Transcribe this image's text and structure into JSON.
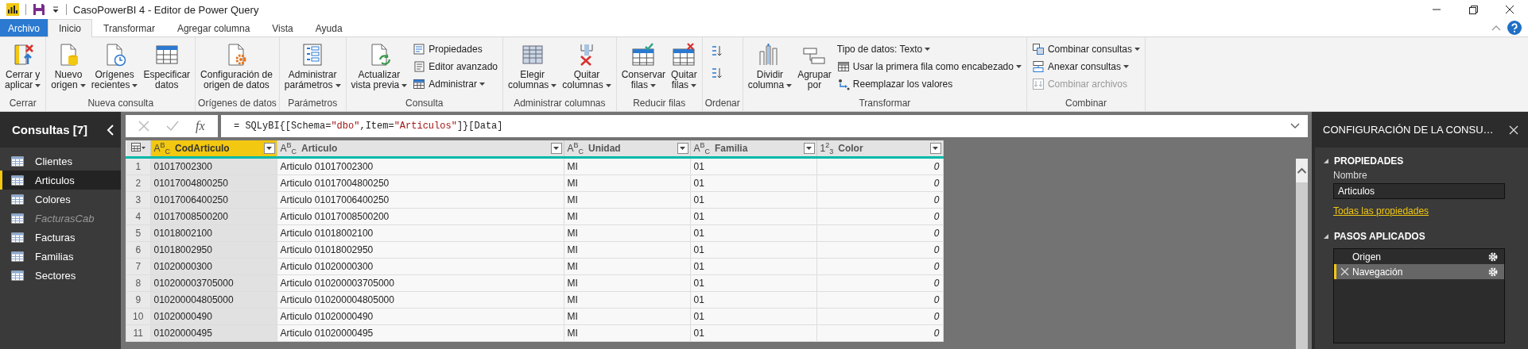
{
  "window": {
    "title": "CasoPowerBI 4 - Editor de Power Query"
  },
  "ribbon_tabs": [
    {
      "label": "Archivo",
      "kind": "file",
      "selected": false
    },
    {
      "label": "Inicio",
      "kind": "tab",
      "selected": true
    },
    {
      "label": "Transformar",
      "kind": "tab",
      "selected": false
    },
    {
      "label": "Agregar columna",
      "kind": "tab",
      "selected": false
    },
    {
      "label": "Vista",
      "kind": "tab",
      "selected": false
    },
    {
      "label": "Ayuda",
      "kind": "tab",
      "selected": false
    }
  ],
  "ribbon_groups": [
    {
      "label": "Cerrar",
      "items": [
        {
          "kind": "large",
          "lines": [
            "Cerrar y",
            "aplicar"
          ],
          "dropdown": true,
          "disabled": false
        }
      ]
    },
    {
      "label": "Nueva consulta",
      "items": [
        {
          "kind": "large",
          "lines": [
            "Nuevo",
            "origen"
          ],
          "dropdown": true,
          "disabled": false
        },
        {
          "kind": "large",
          "lines": [
            "Orígenes",
            "recientes"
          ],
          "dropdown": true,
          "disabled": false
        },
        {
          "kind": "large",
          "lines": [
            "Especificar",
            "datos"
          ],
          "dropdown": false,
          "disabled": false
        }
      ]
    },
    {
      "label": "Orígenes de datos",
      "items": [
        {
          "kind": "large",
          "lines": [
            "Configuración de",
            "origen de datos"
          ],
          "dropdown": false,
          "disabled": false
        }
      ]
    },
    {
      "label": "Parámetros",
      "items": [
        {
          "kind": "large",
          "lines": [
            "Administrar",
            "parámetros"
          ],
          "dropdown": true,
          "disabled": false
        }
      ]
    },
    {
      "label": "Consulta",
      "items": [
        {
          "kind": "large",
          "lines": [
            "Actualizar",
            "vista previa"
          ],
          "dropdown": true,
          "disabled": false
        },
        {
          "kind": "small",
          "lines": [
            "Propiedades"
          ],
          "dropdown": false,
          "disabled": false
        },
        {
          "kind": "small",
          "lines": [
            "Editor avanzado"
          ],
          "dropdown": false,
          "disabled": false
        },
        {
          "kind": "small",
          "lines": [
            "Administrar"
          ],
          "dropdown": true,
          "disabled": false
        }
      ]
    },
    {
      "label": "Administrar columnas",
      "items": [
        {
          "kind": "large",
          "lines": [
            "Elegir",
            "columnas"
          ],
          "dropdown": true,
          "disabled": false
        },
        {
          "kind": "large",
          "lines": [
            "Quitar",
            "columnas"
          ],
          "dropdown": true,
          "disabled": false
        }
      ]
    },
    {
      "label": "Reducir filas",
      "items": [
        {
          "kind": "large",
          "lines": [
            "Conservar",
            "filas"
          ],
          "dropdown": true,
          "disabled": false
        },
        {
          "kind": "large",
          "lines": [
            "Quitar",
            "filas"
          ],
          "dropdown": true,
          "disabled": false
        }
      ]
    },
    {
      "label": "Ordenar",
      "items": [
        {
          "kind": "icon",
          "disabled": false
        },
        {
          "kind": "icon",
          "disabled": false
        }
      ]
    },
    {
      "label": "Transformar",
      "items": [
        {
          "kind": "large",
          "lines": [
            "Dividir",
            "columna"
          ],
          "dropdown": true,
          "disabled": false
        },
        {
          "kind": "large",
          "lines": [
            "Agrupar",
            "por"
          ],
          "dropdown": false,
          "disabled": false
        },
        {
          "kind": "small",
          "lines": [
            "Tipo de datos: Texto"
          ],
          "dropdown": true,
          "disabled": false
        },
        {
          "kind": "small",
          "lines": [
            "Usar la primera fila como encabezado"
          ],
          "dropdown": true,
          "disabled": false
        },
        {
          "kind": "small",
          "lines": [
            "Reemplazar los valores"
          ],
          "dropdown": false,
          "disabled": false
        }
      ]
    },
    {
      "label": "Combinar",
      "items": [
        {
          "kind": "small",
          "lines": [
            "Combinar consultas"
          ],
          "dropdown": true,
          "disabled": false
        },
        {
          "kind": "small",
          "lines": [
            "Anexar consultas"
          ],
          "dropdown": true,
          "disabled": false
        },
        {
          "kind": "small",
          "lines": [
            "Combinar archivos"
          ],
          "dropdown": false,
          "disabled": true
        }
      ]
    }
  ],
  "queries": {
    "title": "Consultas [7]",
    "items": [
      {
        "label": "Clientes",
        "selected": false,
        "disabled": false
      },
      {
        "label": "Articulos",
        "selected": true,
        "disabled": false
      },
      {
        "label": "Colores",
        "selected": false,
        "disabled": false
      },
      {
        "label": "FacturasCab",
        "selected": false,
        "disabled": true
      },
      {
        "label": "Facturas",
        "selected": false,
        "disabled": false
      },
      {
        "label": "Familias",
        "selected": false,
        "disabled": false
      },
      {
        "label": "Sectores",
        "selected": false,
        "disabled": false
      }
    ]
  },
  "formula_bar": {
    "function_label": "fx",
    "formula": [
      {
        "kind": "code",
        "text": "= SQLyBI{[Schema="
      },
      {
        "kind": "string",
        "text": "\"dbo\""
      },
      {
        "kind": "code",
        "text": ",Item="
      },
      {
        "kind": "string",
        "text": "\"Articulos\""
      },
      {
        "kind": "code",
        "text": "]}[Data]"
      }
    ]
  },
  "table": {
    "columns": [
      {
        "name": "CodArticulo",
        "kind": "text",
        "type_label": "A$^{B}$$_{C}$",
        "selected": true
      },
      {
        "name": "Articulo",
        "kind": "text",
        "type_label": "A$^{B}$$_{C}$",
        "selected": false
      },
      {
        "name": "Unidad",
        "kind": "text",
        "type_label": "A$^{B}$$_{C}$",
        "selected": false
      },
      {
        "name": "Familia",
        "kind": "text",
        "type_label": "A$^{B}$$_{C}$",
        "selected": false
      },
      {
        "name": "Color",
        "kind": "number",
        "type_label": "1$^{2}$$_{3}$",
        "selected": false
      }
    ],
    "rows": [
      {
        "number": "1",
        "cells": [
          "01017002300",
          "Articulo 01017002300",
          "MI",
          "01",
          "0"
        ]
      },
      {
        "number": "2",
        "cells": [
          "01017004800250",
          "Articulo 01017004800250",
          "MI",
          "01",
          "0"
        ]
      },
      {
        "number": "3",
        "cells": [
          "01017006400250",
          "Articulo 01017006400250",
          "MI",
          "01",
          "0"
        ]
      },
      {
        "number": "4",
        "cells": [
          "01017008500200",
          "Articulo 01017008500200",
          "MI",
          "01",
          "0"
        ]
      },
      {
        "number": "5",
        "cells": [
          "01018002100",
          "Articulo 01018002100",
          "MI",
          "01",
          "0"
        ]
      },
      {
        "number": "6",
        "cells": [
          "01018002950",
          "Articulo 01018002950",
          "MI",
          "01",
          "0"
        ]
      },
      {
        "number": "7",
        "cells": [
          "01020000300",
          "Articulo 01020000300",
          "MI",
          "01",
          "0"
        ]
      },
      {
        "number": "8",
        "cells": [
          "010200003705000",
          "Articulo 010200003705000",
          "MI",
          "01",
          "0"
        ]
      },
      {
        "number": "9",
        "cells": [
          "010200004805000",
          "Articulo 010200004805000",
          "MI",
          "01",
          "0"
        ]
      },
      {
        "number": "10",
        "cells": [
          "01020000490",
          "Articulo 01020000490",
          "MI",
          "01",
          "0"
        ]
      },
      {
        "number": "11",
        "cells": [
          "01020000495",
          "Articulo 01020000495",
          "MI",
          "01",
          "0"
        ]
      }
    ]
  },
  "query_settings": {
    "title": "CONFIGURACIÓN DE LA CONSU…",
    "properties": {
      "heading": "PROPIEDADES",
      "expanded": true,
      "name_label": "Nombre",
      "name_value": "Articulos",
      "link": "Todas las propiedades"
    },
    "steps": {
      "heading": "PASOS APLICADOS",
      "expanded": true,
      "items": [
        {
          "label": "Origen",
          "selected": false,
          "has_settings": true
        },
        {
          "label": "Navegación",
          "selected": true,
          "has_settings": true
        }
      ]
    }
  }
}
